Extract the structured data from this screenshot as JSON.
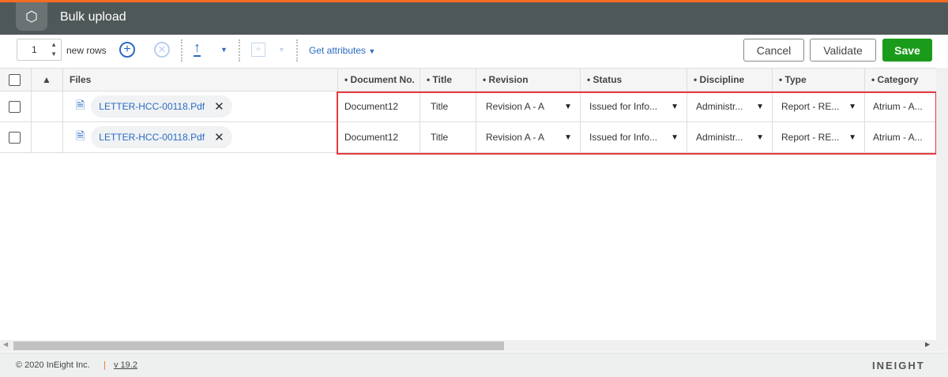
{
  "header": {
    "title": "Bulk upload"
  },
  "toolbar": {
    "rows_value": "1",
    "new_rows_label": "new rows",
    "get_attributes": "Get attributes",
    "cancel": "Cancel",
    "validate": "Validate",
    "save": "Save"
  },
  "grid": {
    "columns": [
      "Files",
      "Document No.",
      "Title",
      "Revision",
      "Status",
      "Discipline",
      "Type",
      "Category"
    ],
    "rows": [
      {
        "file": "LETTER-HCC-00118.Pdf",
        "doc_no": "Document12",
        "title": "Title",
        "revision": "Revision A - A",
        "status": "Issued for Info...",
        "discipline": "Administr...",
        "type": "Report - RE...",
        "category": "Atrium - A..."
      },
      {
        "file": "LETTER-HCC-00118.Pdf",
        "doc_no": "Document12",
        "title": "Title",
        "revision": "Revision A - A",
        "status": "Issued for Info...",
        "discipline": "Administr...",
        "type": "Report - RE...",
        "category": "Atrium - A..."
      }
    ]
  },
  "footer": {
    "copyright": "© 2020 InEight Inc.",
    "divider": "|",
    "version": "v 19.2",
    "brand": "INEIGHT"
  },
  "colors": {
    "accent": "#f26c21",
    "header": "#4f5859",
    "save": "#1a9c1a",
    "link": "#2a6bc2",
    "highlight": "#e53a40"
  }
}
